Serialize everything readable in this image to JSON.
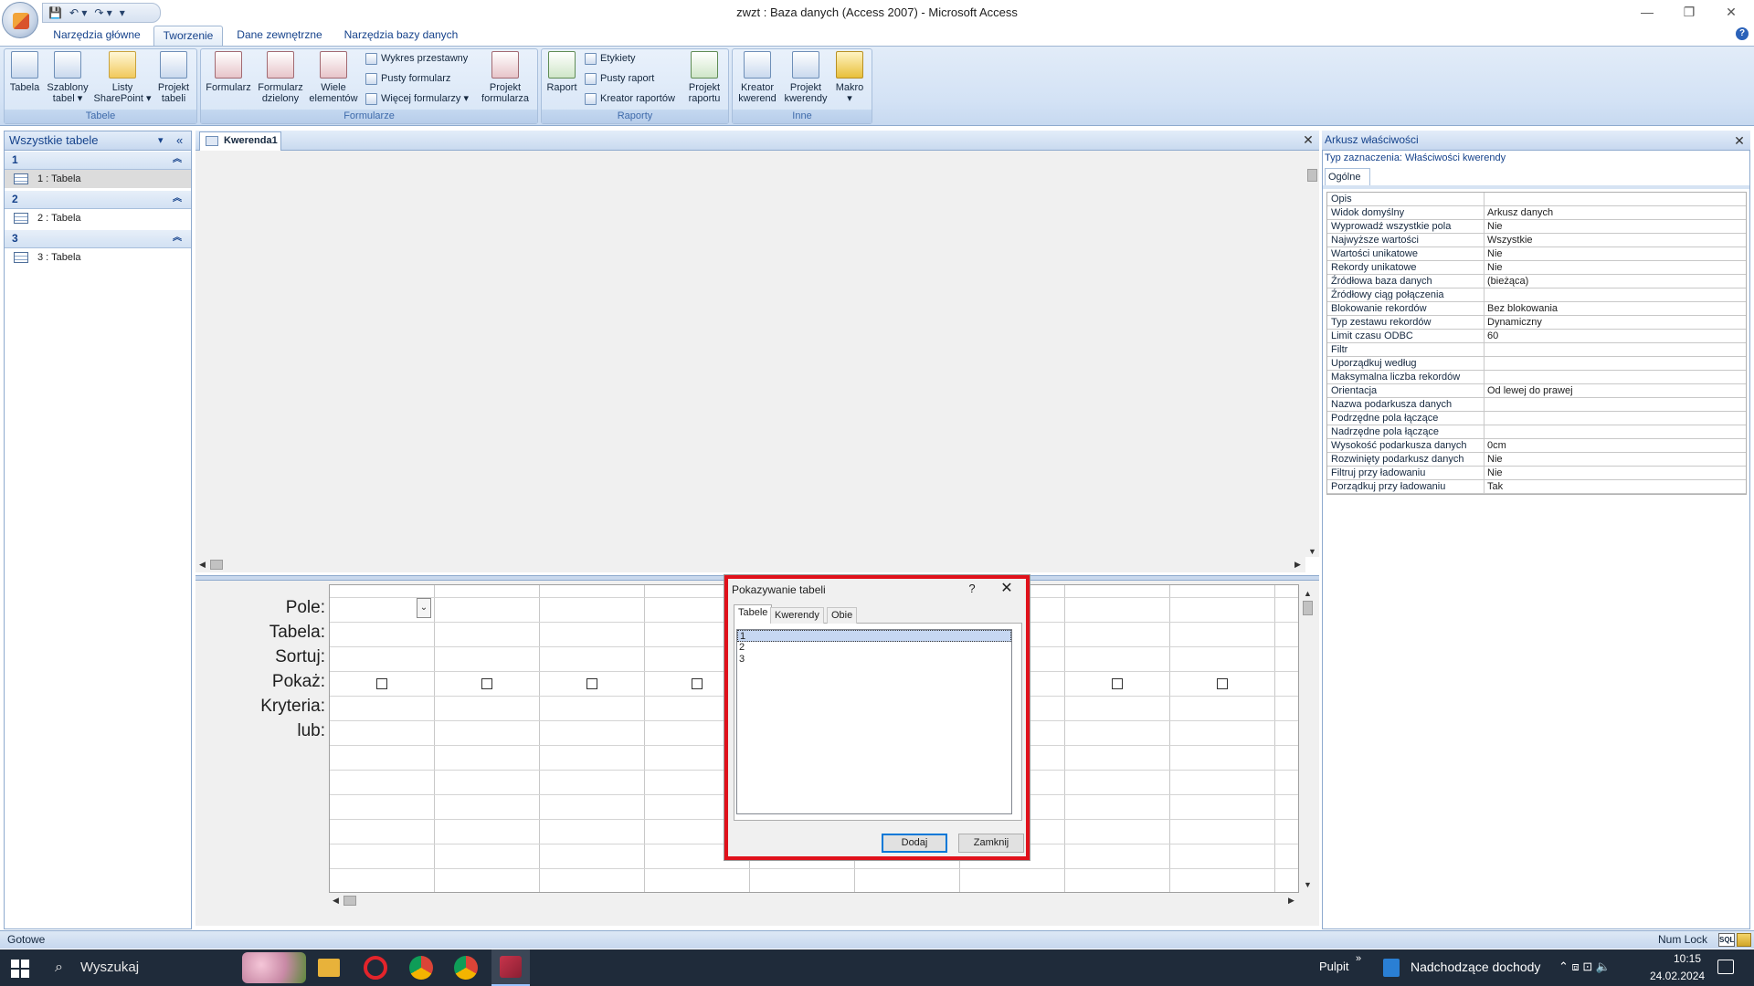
{
  "window": {
    "title": "zwzt : Baza danych (Access 2007) - Microsoft Access",
    "minimize_glyph": "—",
    "restore_glyph": "❐",
    "close_glyph": "✕"
  },
  "qat": {
    "save_glyph": "💾",
    "undo_glyph": "↶ ▾",
    "redo_glyph": "↷ ▾",
    "customize_glyph": "▾"
  },
  "ribbon": {
    "tabs": [
      "Narzędzia główne",
      "Tworzenie",
      "Dane zewnętrzne",
      "Narzędzia bazy danych"
    ],
    "active_tab": "Tworzenie",
    "groups": {
      "tables": {
        "label": "Tabele",
        "buttons": [
          "Tabela",
          "Szablony\ntabel ▾",
          "Listy\nSharePoint ▾",
          "Projekt\ntabeli"
        ]
      },
      "forms": {
        "label": "Formularze",
        "buttons": [
          "Formularz",
          "Formularz\ndzielony",
          "Wiele\nelementów"
        ],
        "small_buttons": [
          "Wykres przestawny",
          "Pusty formularz",
          "Więcej formularzy ▾"
        ],
        "design": "Projekt\nformularza"
      },
      "reports": {
        "label": "Raporty",
        "buttons": [
          "Raport"
        ],
        "small_buttons": [
          "Etykiety",
          "Pusty raport",
          "Kreator raportów"
        ],
        "design": "Projekt\nraportu"
      },
      "other": {
        "label": "Inne",
        "buttons": [
          "Kreator\nkwerend",
          "Projekt\nkwerendy",
          "Makro\n▾"
        ]
      }
    }
  },
  "nav": {
    "header": "Wszystkie tabele",
    "header_dropdown": "▾",
    "collapse_glyph": "«",
    "groups": [
      {
        "label": "1",
        "item": "1 : Tabela"
      },
      {
        "label": "2",
        "item": "2 : Tabela"
      },
      {
        "label": "3",
        "item": "3 : Tabela"
      }
    ],
    "chevron_glyph": "︽"
  },
  "document": {
    "tab": "Kwerenda1",
    "close_glyph": "✕"
  },
  "qbe": {
    "rows": [
      "Pole:",
      "Tabela:",
      "Sortuj:",
      "Pokaż:",
      "Kryteria:",
      "lub:"
    ],
    "dropdown_glyph": "⌄"
  },
  "dialog": {
    "title": "Pokazywanie tabeli",
    "help": "?",
    "close": "✕",
    "tabs": [
      "Tabele",
      "Kwerendy",
      "Obie"
    ],
    "list": [
      "1",
      "2",
      "3"
    ],
    "selected_index": 0,
    "add_button": "Dodaj",
    "close_button": "Zamknij"
  },
  "properties": {
    "title": "Arkusz właściwości",
    "close_glyph": "✕",
    "selection_type": "Typ zaznaczenia:  Właściwości kwerendy",
    "tab": "Ogólne",
    "rows": [
      {
        "k": "Opis",
        "v": ""
      },
      {
        "k": "Widok domyślny",
        "v": "Arkusz danych"
      },
      {
        "k": "Wyprowadź wszystkie pola",
        "v": "Nie"
      },
      {
        "k": "Najwyższe wartości",
        "v": "Wszystkie"
      },
      {
        "k": "Wartości unikatowe",
        "v": "Nie"
      },
      {
        "k": "Rekordy unikatowe",
        "v": "Nie"
      },
      {
        "k": "Źródłowa baza danych",
        "v": "(bieżąca)"
      },
      {
        "k": "Źródłowy ciąg połączenia",
        "v": ""
      },
      {
        "k": "Blokowanie rekordów",
        "v": "Bez blokowania"
      },
      {
        "k": "Typ zestawu rekordów",
        "v": "Dynamiczny"
      },
      {
        "k": "Limit czasu ODBC",
        "v": "60"
      },
      {
        "k": "Filtr",
        "v": ""
      },
      {
        "k": "Uporządkuj według",
        "v": ""
      },
      {
        "k": "Maksymalna liczba rekordów",
        "v": ""
      },
      {
        "k": "Orientacja",
        "v": "Od lewej do prawej"
      },
      {
        "k": "Nazwa podarkusza danych",
        "v": ""
      },
      {
        "k": "Podrzędne pola łączące",
        "v": ""
      },
      {
        "k": "Nadrzędne pola łączące",
        "v": ""
      },
      {
        "k": "Wysokość podarkusza danych",
        "v": "0cm"
      },
      {
        "k": "Rozwinięty podarkusz danych",
        "v": "Nie"
      },
      {
        "k": "Filtruj przy ładowaniu",
        "v": "Nie"
      },
      {
        "k": "Porządkuj przy ładowaniu",
        "v": "Tak"
      }
    ]
  },
  "status": {
    "left": "Gotowe",
    "num_lock": "Num Lock",
    "sql_badge": "SQL"
  },
  "taskbar": {
    "search": "Wyszukaj",
    "desktop_label": "Pulpit",
    "desktop_chevron": "»",
    "news": "Nadchodzące dochody",
    "time": "10:15",
    "date": "24.02.2024",
    "tray_glyphs": "⌃  ⧈  ⊡  🔈"
  },
  "colors": {
    "dialog_highlight": "#e0111b",
    "ribbon_accent": "#15428b"
  }
}
